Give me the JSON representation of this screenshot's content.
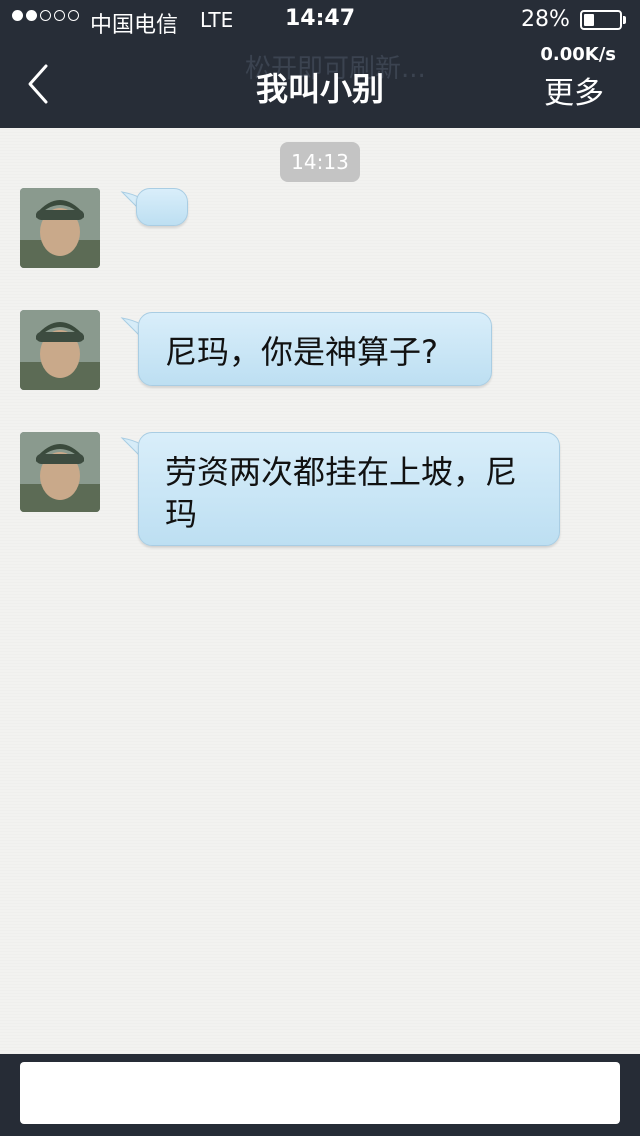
{
  "status_bar": {
    "carrier": "中国电信",
    "network": "LTE",
    "time": "14:47",
    "battery_text": "28%",
    "battery_level": 0.28,
    "signal_bars_filled": 2,
    "signal_bars_total": 5
  },
  "nav": {
    "title": "我叫小别",
    "more_label": "更多",
    "net_speed": "0.00K/s",
    "refresh_hint": "松开即可刷新..."
  },
  "chat": {
    "timestamp": "14:13",
    "messages": [
      {
        "text": ""
      },
      {
        "text": "尼玛，你是神算子?"
      },
      {
        "text": "劳资两次都挂在上坡，尼玛"
      }
    ]
  },
  "input": {
    "value": "",
    "placeholder": ""
  },
  "colors": {
    "bar_background": "#272d37",
    "bubble_top": "#d9eefa",
    "bubble_bottom": "#bddff2",
    "timestamp_pill": "#c4c4c4"
  }
}
